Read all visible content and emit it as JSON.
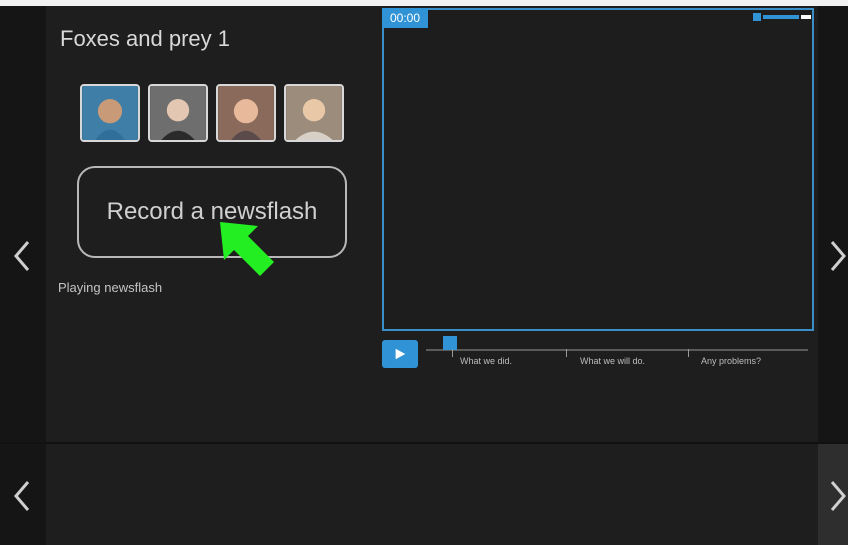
{
  "project": {
    "title": "Foxes and prey 1"
  },
  "team": {
    "avatars": [
      {
        "name": "team-member-1-avatar",
        "bg": "#3f7ea6"
      },
      {
        "name": "team-member-2-avatar",
        "bg": "#6e6e6e"
      },
      {
        "name": "team-member-3-avatar",
        "bg": "#8a6a5a"
      },
      {
        "name": "team-member-4-avatar",
        "bg": "#9b8c7c"
      }
    ]
  },
  "record_button": {
    "label": "Record a newsflash"
  },
  "status": {
    "text": "Playing newsflash"
  },
  "player": {
    "timecode": "00:00",
    "chapters": [
      "What we did.",
      "What we will do.",
      "Any problems?"
    ]
  },
  "colors": {
    "accent": "#2f93d6",
    "cursor": "#22ee22"
  },
  "icons": {
    "prev": "chevron-left-icon",
    "next": "chevron-right-icon",
    "play": "play-icon",
    "cursor": "arrow-cursor-icon"
  }
}
